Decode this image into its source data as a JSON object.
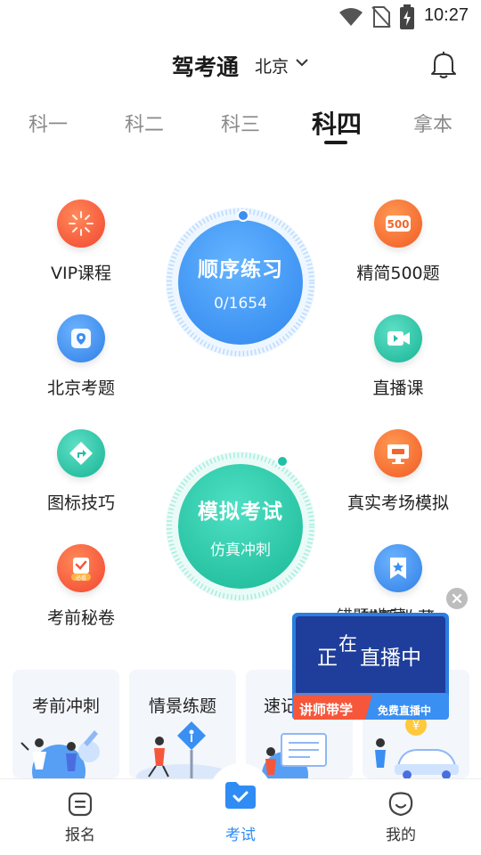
{
  "status_bar": {
    "time": "10:27"
  },
  "header": {
    "app_title": "驾考通",
    "city": "北京"
  },
  "tabs": [
    {
      "label": "科一",
      "active": false
    },
    {
      "label": "科二",
      "active": false
    },
    {
      "label": "科三",
      "active": false
    },
    {
      "label": "科四",
      "active": true
    },
    {
      "label": "拿本",
      "active": false
    }
  ],
  "features_left": [
    {
      "label": "VIP课程",
      "icon": "vip-icon",
      "color": "#f6573b"
    },
    {
      "label": "北京考题",
      "icon": "location-pin-icon",
      "color": "#3a8ff2"
    },
    {
      "label": "图标技巧",
      "icon": "road-sign-icon",
      "color": "#22c0a6"
    },
    {
      "label": "考前秘卷",
      "icon": "exam-paper-icon",
      "color": "#f6573b",
      "badge": "必看"
    }
  ],
  "features_right": [
    {
      "label": "精简500题",
      "icon": "500-badge-icon",
      "color": "#f3652a",
      "badge": "500"
    },
    {
      "label": "直播课",
      "icon": "video-camera-icon",
      "color": "#22c0a6"
    },
    {
      "label": "真实考场模拟",
      "icon": "monitor-icon",
      "color": "#f3652a"
    },
    {
      "label": "错题 收藏",
      "icon": "bookmark-star-icon",
      "color": "#3a8ff2"
    }
  ],
  "practice": {
    "title": "顺序练习",
    "progress": "0/1654",
    "done": 0,
    "total": 1654
  },
  "mock_exam": {
    "title": "模拟考试",
    "subtitle": "仿真冲刺"
  },
  "cards": [
    {
      "title": "考前冲刺"
    },
    {
      "title": "情景练题"
    },
    {
      "title": "速记"
    },
    {
      "title": ""
    }
  ],
  "live_popup": {
    "title_part1": "正",
    "title_part2": "在",
    "title_part3": "直播中",
    "banner_left": "讲师带学",
    "banner_right": "免费直播中"
  },
  "bottom_nav": [
    {
      "label": "报名",
      "icon": "signup-icon",
      "active": false
    },
    {
      "label": "考试",
      "icon": "exam-folder-icon",
      "active": true
    },
    {
      "label": "我的",
      "icon": "profile-face-icon",
      "active": false
    }
  ],
  "colors": {
    "accent": "#2f8cf4",
    "practice_blue": "#3a8ff2",
    "mock_green": "#22c0a6",
    "orange": "#f6573b"
  }
}
